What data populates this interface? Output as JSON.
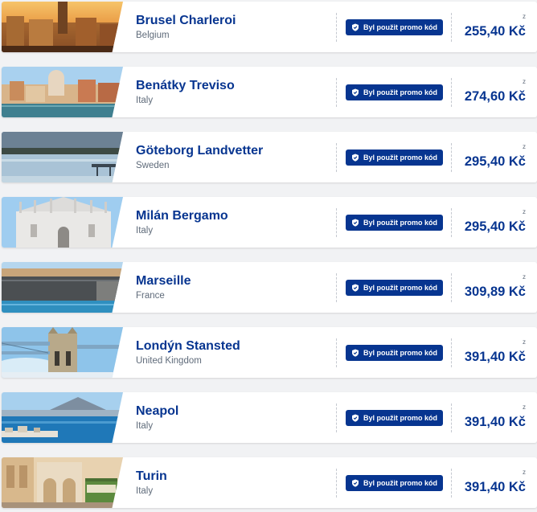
{
  "from_label": "z",
  "promo_label": "Byl použit promo kód",
  "colors": {
    "brand": "#073590",
    "background": "#f1f2f4",
    "muted_text": "#5f6b7a"
  },
  "icons": {
    "promo_icon": "shield-check-icon"
  },
  "destinations": [
    {
      "city": "Brusel Charleroi",
      "country": "Belgium",
      "price": "255,40 Kč",
      "image": "brussels-grand-place-photo"
    },
    {
      "city": "Benátky Treviso",
      "country": "Italy",
      "price": "274,60 Kč",
      "image": "venice-canal-photo"
    },
    {
      "city": "Göteborg Landvetter",
      "country": "Sweden",
      "price": "295,40 Kč",
      "image": "gothenburg-harbour-photo"
    },
    {
      "city": "Milán Bergamo",
      "country": "Italy",
      "price": "295,40 Kč",
      "image": "milan-cathedral-photo"
    },
    {
      "city": "Marseille",
      "country": "France",
      "price": "309,89 Kč",
      "image": "marseille-port-photo"
    },
    {
      "city": "Londýn Stansted",
      "country": "United Kingdom",
      "price": "391,40 Kč",
      "image": "tower-bridge-photo"
    },
    {
      "city": "Neapol",
      "country": "Italy",
      "price": "391,40 Kč",
      "image": "naples-bay-photo"
    },
    {
      "city": "Turin",
      "country": "Italy",
      "price": "391,40 Kč",
      "image": "turin-tram-street-photo"
    }
  ]
}
